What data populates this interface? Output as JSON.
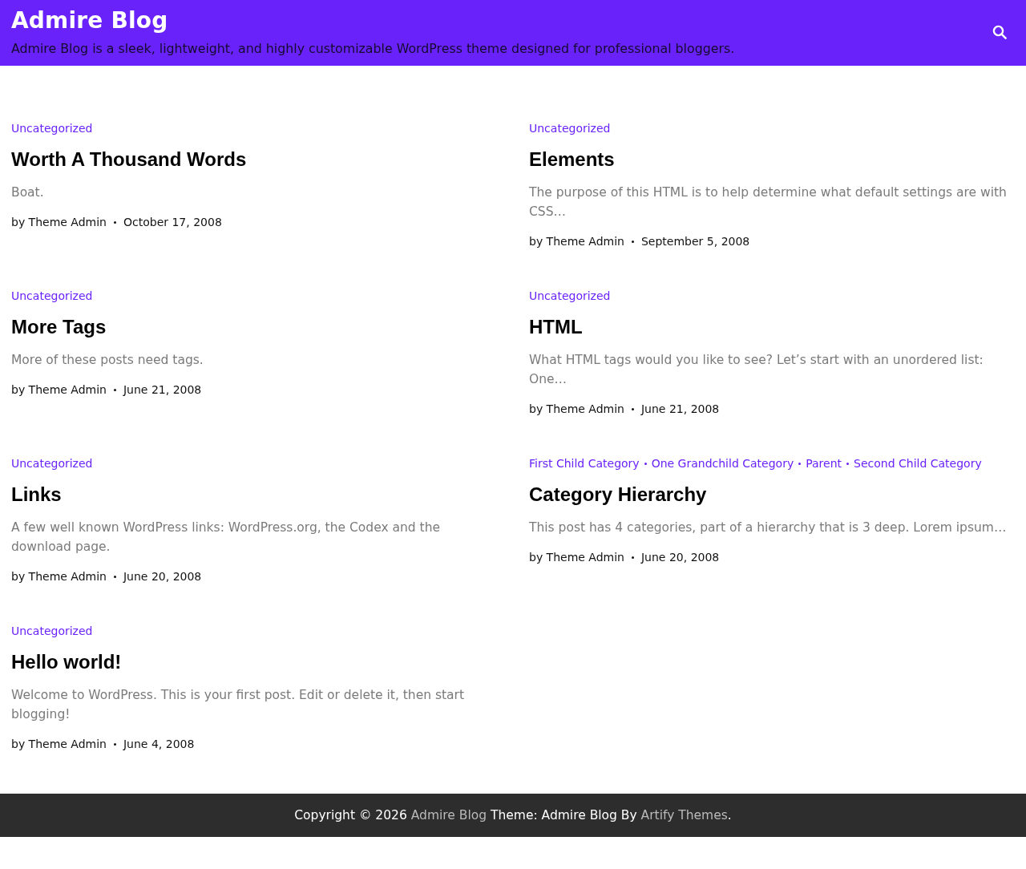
{
  "header": {
    "site_title": "Admire Blog",
    "tagline": "Admire Blog is a sleek, lightweight, and highly customizable WordPress theme designed for professional bloggers."
  },
  "posts": [
    {
      "categories": [
        "Uncategorized"
      ],
      "title": "Worth A Thousand Words",
      "excerpt": "Boat.",
      "author": "by Theme Admin",
      "date": "October 17, 2008"
    },
    {
      "categories": [
        "Uncategorized"
      ],
      "title": "Elements",
      "excerpt": "The purpose of this HTML is to help determine what default settings are with CSS…",
      "author": "by Theme Admin",
      "date": "September 5, 2008"
    },
    {
      "categories": [
        "Uncategorized"
      ],
      "title": "More Tags",
      "excerpt": "More of these posts need tags.",
      "author": "by Theme Admin",
      "date": "June 21, 2008"
    },
    {
      "categories": [
        "Uncategorized"
      ],
      "title": "HTML",
      "excerpt": "What HTML tags would you like to see? Let’s start with an unordered list: One…",
      "author": "by Theme Admin",
      "date": "June 21, 2008"
    },
    {
      "categories": [
        "Uncategorized"
      ],
      "title": "Links",
      "excerpt": "A few well known WordPress links: WordPress.org, the Codex and the download page.",
      "author": "by Theme Admin",
      "date": "June 20, 2008"
    },
    {
      "categories": [
        "First Child Category",
        "One Grandchild Category",
        "Parent",
        "Second Child Category"
      ],
      "title": "Category Hierarchy",
      "excerpt": "This post has 4 categories, part of a hierarchy that is 3 deep. Lorem ipsum…",
      "author": "by Theme Admin",
      "date": "June 20, 2008"
    },
    {
      "categories": [
        "Uncategorized"
      ],
      "title": "Hello world!",
      "excerpt": "Welcome to WordPress. This is your first post. Edit or delete it, then start blogging!",
      "author": "by Theme Admin",
      "date": "June 4, 2008"
    }
  ],
  "footer": {
    "prefix": "Copyright © 2026",
    "site_link": "Admire Blog",
    "theme_text": "Theme: Admire Blog By",
    "author_link": "Artify Themes",
    "suffix": "."
  }
}
